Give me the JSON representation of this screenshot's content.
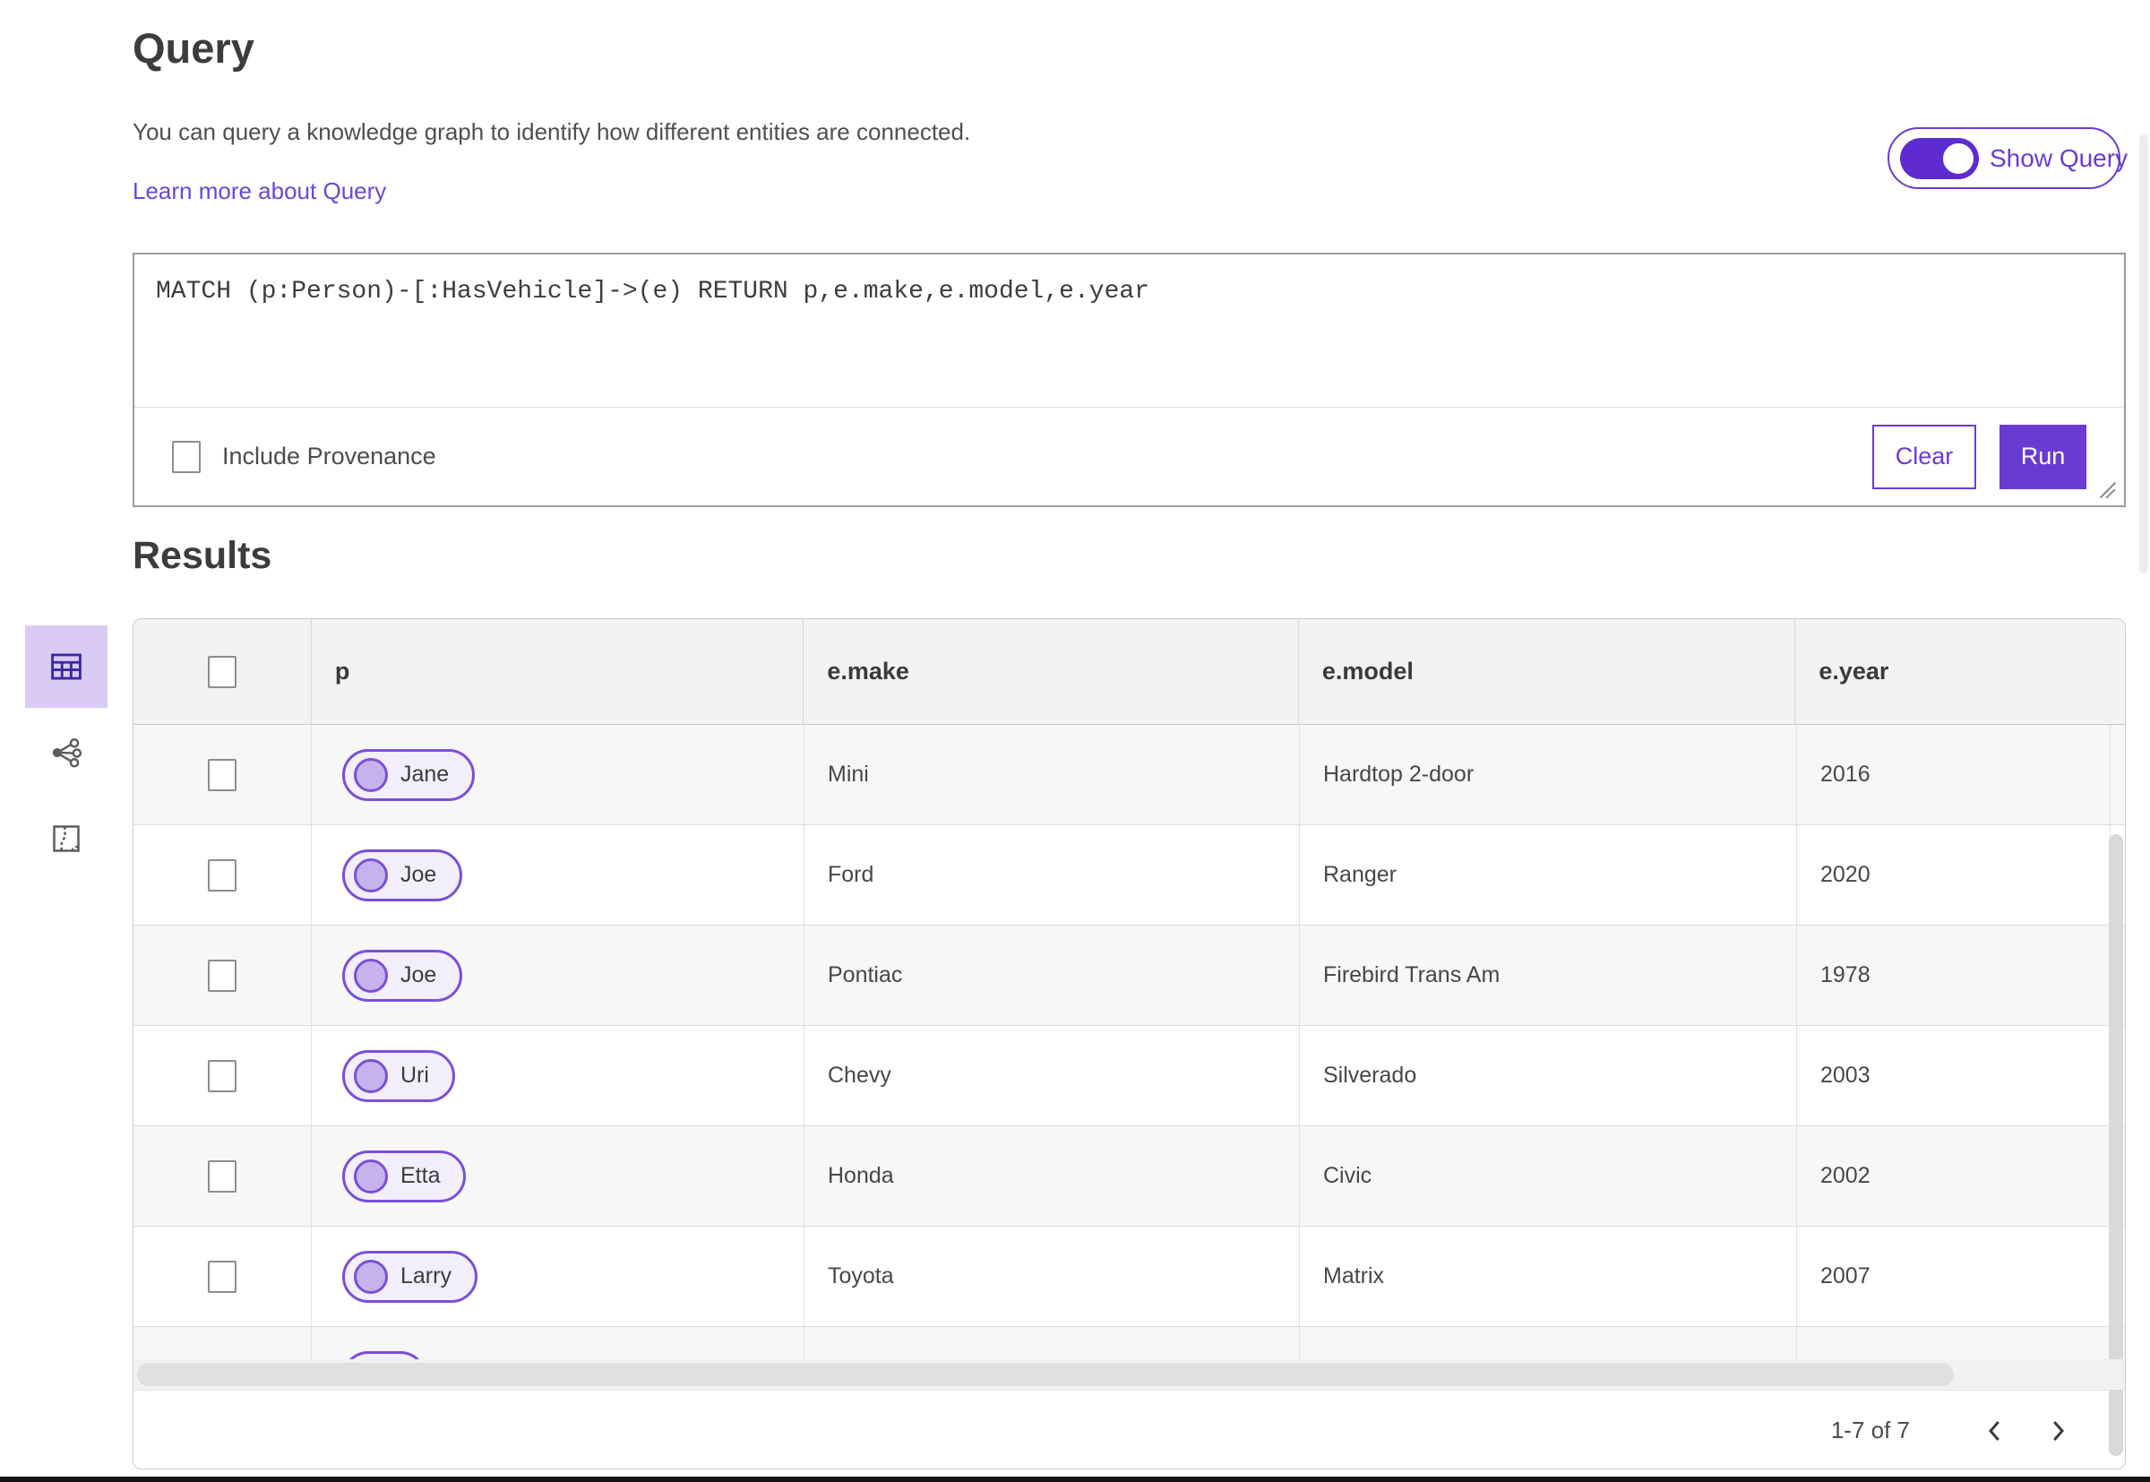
{
  "colors": {
    "accent": "#6a3bd3",
    "toggle": "#5e2bd0",
    "selected_tile": "#d9cbf6",
    "pill_border": "#7a4fd7",
    "pill_fill": "#f2eefb"
  },
  "query_section": {
    "title": "Query",
    "description": "You can query a knowledge graph to identify how different entities are connected.",
    "learn_more_label": "Learn more about Query",
    "show_query_label": "Show Query",
    "show_query_on": true,
    "query_text": "MATCH (p:Person)-[:HasVehicle]->(e) RETURN p,e.make,e.model,e.year",
    "include_provenance_label": "Include Provenance",
    "include_provenance_checked": false,
    "clear_label": "Clear",
    "run_label": "Run"
  },
  "results_section": {
    "title": "Results",
    "view_options": [
      {
        "icon": "table-view-icon",
        "selected": true
      },
      {
        "icon": "link-chart-view-icon",
        "selected": false
      },
      {
        "icon": "map-view-icon",
        "selected": false
      }
    ],
    "table": {
      "columns": {
        "p": "p",
        "make": "e.make",
        "model": "e.model",
        "year": "e.year"
      },
      "rows": [
        {
          "p": "Jane",
          "make": "Mini",
          "model": "Hardtop 2-door",
          "year": "2016"
        },
        {
          "p": "Joe",
          "make": "Ford",
          "model": "Ranger",
          "year": "2020"
        },
        {
          "p": "Joe",
          "make": "Pontiac",
          "model": "Firebird Trans Am",
          "year": "1978"
        },
        {
          "p": "Uri",
          "make": "Chevy",
          "model": "Silverado",
          "year": "2003"
        },
        {
          "p": "Etta",
          "make": "Honda",
          "model": "Civic",
          "year": "2002"
        },
        {
          "p": "Larry",
          "make": "Toyota",
          "model": "Matrix",
          "year": "2007"
        }
      ],
      "partial_row_visible": true
    },
    "pagination": {
      "range_label": "1-7 of 7"
    }
  }
}
